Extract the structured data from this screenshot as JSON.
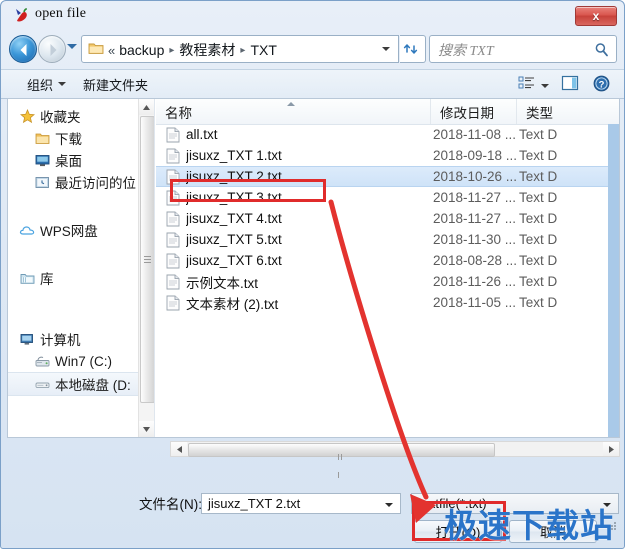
{
  "window": {
    "title": "open file",
    "title_icon": "app-chili-icon",
    "close_label": "x"
  },
  "addressbar": {
    "back_icon": "back-arrow-icon",
    "forward_icon": "forward-arrow-icon",
    "recent_icon": "chevron-down-icon",
    "folder_icon": "folder-icon",
    "overflow": "«",
    "crumbs": [
      "backup",
      "教程素材",
      "TXT"
    ],
    "separator": "▸",
    "dropdown_icon": "chevron-down-icon",
    "refresh_icon": "refresh-icon",
    "search_placeholder": "搜索 TXT",
    "search_icon": "search-icon"
  },
  "toolbar": {
    "organize_label": "组织",
    "new_folder_label": "新建文件夹",
    "view_icon": "view-list-icon",
    "preview_icon": "preview-pane-icon",
    "help_icon": "help-icon"
  },
  "nav_pane": {
    "items": [
      {
        "label": "收藏夹",
        "icon": "star-icon",
        "level": 0,
        "selected": false
      },
      {
        "label": "下载",
        "icon": "folder-icon",
        "level": 1,
        "selected": false
      },
      {
        "label": "桌面",
        "icon": "desktop-icon",
        "level": 1,
        "selected": false
      },
      {
        "label": "最近访问的位",
        "icon": "recent-places-icon",
        "level": 1,
        "selected": false
      },
      {
        "label": "WPS网盘",
        "icon": "cloud-icon",
        "level": 0,
        "selected": false
      },
      {
        "label": "库",
        "icon": "library-icon",
        "level": 0,
        "selected": false
      },
      {
        "label": "计算机",
        "icon": "computer-icon",
        "level": 0,
        "selected": false
      },
      {
        "label": "Win7 (C:)",
        "icon": "hard-drive-icon",
        "level": 1,
        "selected": false
      },
      {
        "label": "本地磁盘 (D:",
        "icon": "local-disk-icon",
        "level": 1,
        "selected": true
      }
    ],
    "scroll_up_icon": "scroll-up-arrow-icon",
    "scroll_down_icon": "scroll-down-arrow-icon"
  },
  "file_list": {
    "columns": [
      "名称",
      "修改日期",
      "类型"
    ],
    "sort_column": "名称",
    "sort_icon": "sort-ascending-icon",
    "rows": [
      {
        "name": "all.txt",
        "date": "2018-11-08 ...",
        "type": "Text D",
        "selected": false
      },
      {
        "name": "jisuxz_TXT 1.txt",
        "date": "2018-09-18 ...",
        "type": "Text D",
        "selected": false
      },
      {
        "name": "jisuxz_TXT 2.txt",
        "date": "2018-10-26 ...",
        "type": "Text D",
        "selected": true
      },
      {
        "name": "jisuxz_TXT 3.txt",
        "date": "2018-11-27 ...",
        "type": "Text D",
        "selected": false
      },
      {
        "name": "jisuxz_TXT 4.txt",
        "date": "2018-11-27 ...",
        "type": "Text D",
        "selected": false
      },
      {
        "name": "jisuxz_TXT 5.txt",
        "date": "2018-11-30 ...",
        "type": "Text D",
        "selected": false
      },
      {
        "name": "jisuxz_TXT 6.txt",
        "date": "2018-08-28 ...",
        "type": "Text D",
        "selected": false
      },
      {
        "name": "示例文本.txt",
        "date": "2018-11-26 ...",
        "type": "Text D",
        "selected": false
      },
      {
        "name": "文本素材 (2).txt",
        "date": "2018-11-05 ...",
        "type": "Text D",
        "selected": false
      }
    ]
  },
  "scrollbars": {
    "h_left_icon": "scroll-left-arrow-icon",
    "h_right_icon": "scroll-right-arrow-icon"
  },
  "footer": {
    "filename_label": "文件名(N):",
    "filename_value": "jisuxz_TXT 2.txt",
    "filetype_value": "textfile(*.txt)",
    "open_label": "打开(O)",
    "cancel_label": "取消",
    "resize_grip_icon": "resize-grip-icon"
  },
  "annotations": {
    "watermark_text": "极速下载站",
    "highlight_color": "#e02b2b",
    "watermark_color": "#2a74c9",
    "selection_color": "#cfe3f8"
  }
}
